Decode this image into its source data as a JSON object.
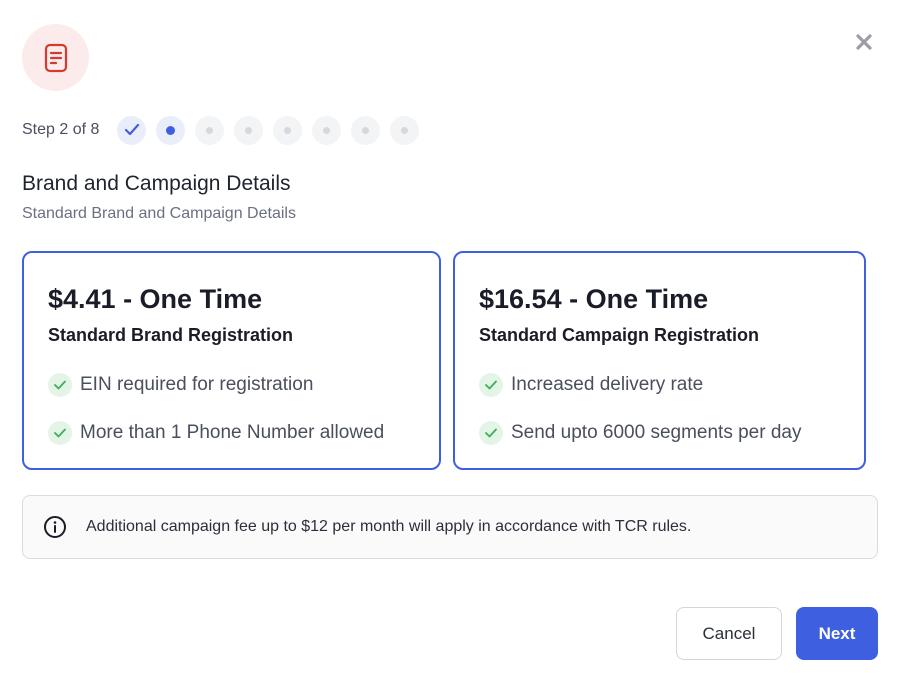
{
  "header": {
    "icon": "document-icon",
    "icon_color": "#d43a2f"
  },
  "stepper": {
    "label": "Step 2 of 8",
    "current": 2,
    "total": 8,
    "accent": "#3e5fe0"
  },
  "section": {
    "title": "Brand and Campaign Details",
    "subtitle": "Standard Brand and Campaign Details"
  },
  "plans": [
    {
      "price": "$4.41 - One Time",
      "name": "Standard Brand Registration",
      "features": [
        "EIN required for registration",
        "More than 1 Phone Number allowed"
      ]
    },
    {
      "price": "$16.54 - One Time",
      "name": "Standard Campaign Registration",
      "features": [
        "Increased delivery rate",
        "Send upto 6000 segments per day"
      ]
    }
  ],
  "notice": {
    "icon": "info-icon",
    "text": "Additional campaign fee up to $12 per month will apply in accordance with TCR rules."
  },
  "actions": {
    "cancel_label": "Cancel",
    "next_label": "Next"
  },
  "colors": {
    "accent": "#3e5fe0",
    "check_green": "#3fae5a",
    "check_bg": "#e4f5e8"
  }
}
